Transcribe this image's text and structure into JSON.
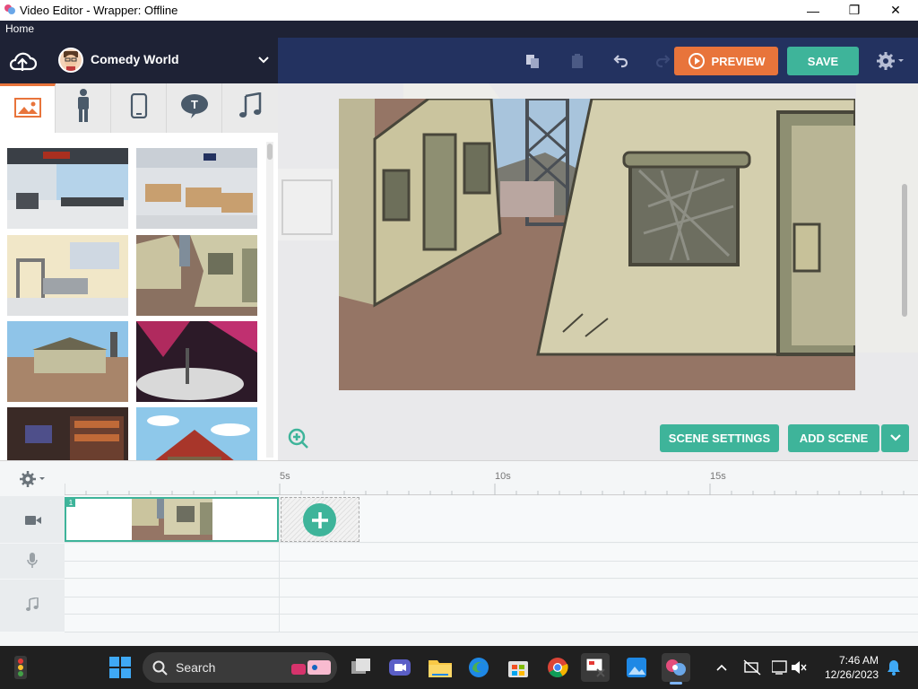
{
  "window": {
    "title": "Video Editor - Wrapper: Offline"
  },
  "menu": {
    "home": "Home"
  },
  "toolbar": {
    "theme_name": "Comedy World",
    "preview_label": "PREVIEW",
    "save_label": "SAVE"
  },
  "library": {
    "tabs": [
      {
        "icon": "backgrounds-icon",
        "active": true
      },
      {
        "icon": "characters-icon",
        "active": false
      },
      {
        "icon": "props-icon",
        "active": false
      },
      {
        "icon": "text-icon",
        "active": false
      },
      {
        "icon": "music-icon",
        "active": false
      }
    ],
    "backgrounds": [
      "airport-terminal",
      "airport-checkin",
      "airport-security",
      "military-camp",
      "farm-houses",
      "stage-spotlights",
      "store-interior",
      "cabin-house"
    ]
  },
  "stage": {
    "scene_settings_label": "SCENE SETTINGS",
    "add_scene_label": "ADD SCENE"
  },
  "timeline": {
    "ruler_marks": [
      "5s",
      "10s",
      "15s"
    ],
    "scenes": [
      {
        "number": "1"
      }
    ],
    "tracks": [
      "video-track",
      "voice-track",
      "music-track"
    ]
  },
  "taskbar": {
    "search_label": "Search",
    "time": "7:46 AM",
    "date": "12/26/2023"
  },
  "colors": {
    "accent_teal": "#3eb49a",
    "accent_orange": "#e8743b",
    "toolbar_navy": "#233260"
  }
}
